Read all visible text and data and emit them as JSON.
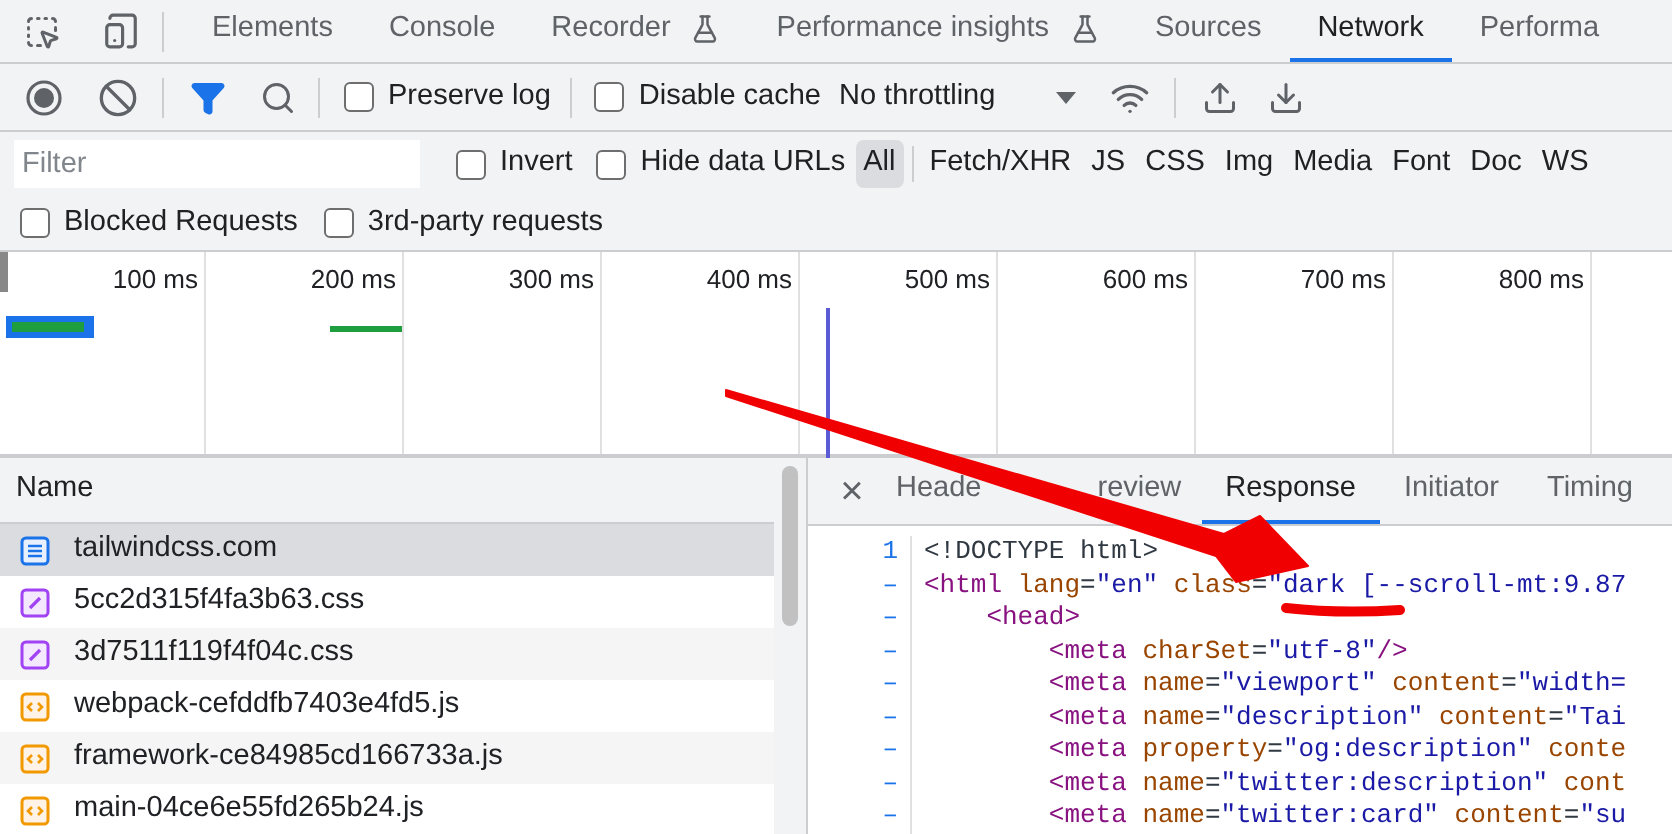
{
  "top_tabs": [
    {
      "label": "Elements",
      "selected": false,
      "experimental": false
    },
    {
      "label": "Console",
      "selected": false,
      "experimental": false
    },
    {
      "label": "Recorder",
      "selected": false,
      "experimental": true
    },
    {
      "label": "Performance insights",
      "selected": false,
      "experimental": true
    },
    {
      "label": "Sources",
      "selected": false,
      "experimental": false
    },
    {
      "label": "Network",
      "selected": true,
      "experimental": false
    },
    {
      "label": "Performa",
      "selected": false,
      "experimental": false
    }
  ],
  "toolbar": {
    "checkboxes": [
      {
        "label": "Preserve log",
        "checked": false
      },
      {
        "label": "Disable cache",
        "checked": false
      }
    ],
    "throttling": "No throttling"
  },
  "filter": {
    "placeholder": "Filter",
    "checkboxes": [
      {
        "label": "Invert",
        "checked": false
      },
      {
        "label": "Hide data URLs",
        "checked": false
      }
    ],
    "types": [
      {
        "label": "All",
        "selected": true
      },
      {
        "label": "Fetch/XHR",
        "selected": false
      },
      {
        "label": "JS",
        "selected": false
      },
      {
        "label": "CSS",
        "selected": false
      },
      {
        "label": "Img",
        "selected": false
      },
      {
        "label": "Media",
        "selected": false
      },
      {
        "label": "Font",
        "selected": false
      },
      {
        "label": "Doc",
        "selected": false
      },
      {
        "label": "WS",
        "selected": false
      }
    ]
  },
  "extra_filters": [
    {
      "label": "Blocked Requests",
      "checked": false
    },
    {
      "label": "3rd-party requests",
      "checked": false
    }
  ],
  "timeline": {
    "ticks": [
      "100 ms",
      "200 ms",
      "300 ms",
      "400 ms",
      "500 ms",
      "600 ms",
      "700 ms",
      "800 ms"
    ]
  },
  "requests": {
    "column": "Name",
    "rows": [
      {
        "name": "tailwindcss.com",
        "kind": "document",
        "selected": true
      },
      {
        "name": "5cc2d315f4fa3b63.css",
        "kind": "stylesheet",
        "selected": false
      },
      {
        "name": "3d7511f119f4f04c.css",
        "kind": "stylesheet",
        "selected": false
      },
      {
        "name": "webpack-cefddfb7403e4fd5.js",
        "kind": "script",
        "selected": false
      },
      {
        "name": "framework-ce84985cd166733a.js",
        "kind": "script",
        "selected": false
      },
      {
        "name": "main-04ce6e55fd265b24.js",
        "kind": "script",
        "selected": false
      }
    ]
  },
  "detail": {
    "close": "×",
    "tabs": [
      {
        "label": "Heade",
        "selected": false
      },
      {
        "label": "review",
        "selected": false
      },
      {
        "label": "Response",
        "selected": true
      },
      {
        "label": "Initiator",
        "selected": false
      },
      {
        "label": "Timing",
        "selected": false
      }
    ],
    "lines": [
      {
        "number": "1",
        "tokens": [
          {
            "kind": "doctype",
            "text": "<!DOCTYPE html>"
          }
        ]
      },
      {
        "number": "–",
        "tokens": [
          {
            "kind": "tag",
            "text": "<html"
          },
          {
            "kind": "attr",
            "text": "lang"
          },
          {
            "kind": "punct",
            "text": "="
          },
          {
            "kind": "value",
            "text": "\"en\""
          },
          {
            "kind": "attr",
            "text": "class"
          },
          {
            "kind": "punct",
            "text": "="
          },
          {
            "kind": "value",
            "text": "\"dark [--scroll-mt:9.87"
          }
        ],
        "children": [
          {
            "number": "–",
            "tokens": [
              {
                "kind": "tag",
                "text": "<head>"
              }
            ],
            "children": [
              {
                "number": "–",
                "tokens": [
                  {
                    "kind": "tag",
                    "text": "<meta"
                  },
                  {
                    "kind": "attr",
                    "text": "charSet"
                  },
                  {
                    "kind": "punct",
                    "text": "="
                  },
                  {
                    "kind": "value",
                    "text": "\"utf-8\""
                  },
                  {
                    "kind": "tag",
                    "text": "/>"
                  }
                ]
              },
              {
                "number": "–",
                "tokens": [
                  {
                    "kind": "tag",
                    "text": "<meta"
                  },
                  {
                    "kind": "attr",
                    "text": "name"
                  },
                  {
                    "kind": "punct",
                    "text": "="
                  },
                  {
                    "kind": "value",
                    "text": "\"viewport\""
                  },
                  {
                    "kind": "attr",
                    "text": "content"
                  },
                  {
                    "kind": "punct",
                    "text": "="
                  },
                  {
                    "kind": "value",
                    "text": "\"width="
                  }
                ]
              },
              {
                "number": "–",
                "tokens": [
                  {
                    "kind": "tag",
                    "text": "<meta"
                  },
                  {
                    "kind": "attr",
                    "text": "name"
                  },
                  {
                    "kind": "punct",
                    "text": "="
                  },
                  {
                    "kind": "value",
                    "text": "\"description\""
                  },
                  {
                    "kind": "attr",
                    "text": "content"
                  },
                  {
                    "kind": "punct",
                    "text": "="
                  },
                  {
                    "kind": "value",
                    "text": "\"Tai"
                  }
                ]
              },
              {
                "number": "–",
                "tokens": [
                  {
                    "kind": "tag",
                    "text": "<meta"
                  },
                  {
                    "kind": "attr",
                    "text": "property"
                  },
                  {
                    "kind": "punct",
                    "text": "="
                  },
                  {
                    "kind": "value",
                    "text": "\"og:description\""
                  },
                  {
                    "kind": "attr",
                    "text": "conte"
                  }
                ]
              },
              {
                "number": "–",
                "tokens": [
                  {
                    "kind": "tag",
                    "text": "<meta"
                  },
                  {
                    "kind": "attr",
                    "text": "name"
                  },
                  {
                    "kind": "punct",
                    "text": "="
                  },
                  {
                    "kind": "value",
                    "text": "\"twitter:description\""
                  },
                  {
                    "kind": "attr",
                    "text": "cont"
                  }
                ]
              },
              {
                "number": "–",
                "tokens": [
                  {
                    "kind": "tag",
                    "text": "<meta"
                  },
                  {
                    "kind": "attr",
                    "text": "name"
                  },
                  {
                    "kind": "punct",
                    "text": "="
                  },
                  {
                    "kind": "value",
                    "text": "\"twitter:card\""
                  },
                  {
                    "kind": "attr",
                    "text": "content"
                  },
                  {
                    "kind": "punct",
                    "text": "="
                  },
                  {
                    "kind": "value",
                    "text": "\"su"
                  }
                ]
              }
            ]
          }
        ]
      }
    ]
  }
}
